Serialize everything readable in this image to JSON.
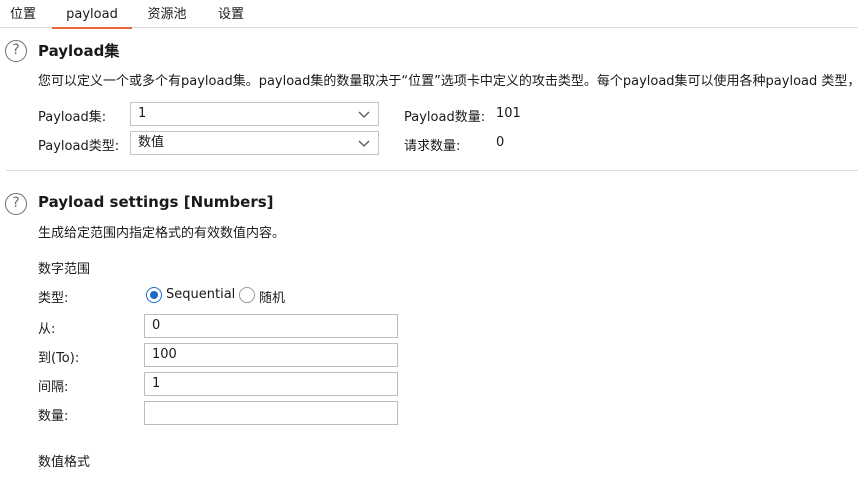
{
  "tabs": [
    {
      "label": "位置"
    },
    {
      "label": "payload"
    },
    {
      "label": "资源池"
    },
    {
      "label": "设置"
    }
  ],
  "payload_sets": {
    "help_glyph": "?",
    "title": "Payload集",
    "description": "您可以定义一个或多个有payload集。payload集的数量取决于“位置”选项卡中定义的攻击类型。每个payload集可以使用各种payload 类型，并且",
    "set_label": "Payload集:",
    "set_value": "1",
    "type_label": "Payload类型:",
    "type_value": "数值",
    "count_label": "Payload数量:",
    "count_value": "101",
    "request_label": "请求数量:",
    "request_value": "0"
  },
  "payload_settings": {
    "help_glyph": "?",
    "title": "Payload settings [Numbers]",
    "description": "生成给定范围内指定格式的有效数值内容。",
    "range_heading": "数字范围",
    "type_label": "类型:",
    "sequential_label": "Sequential",
    "random_label": "随机",
    "selected": "Sequential",
    "from_label": "从:",
    "from_value": "0",
    "to_label": "到(To):",
    "to_value": "100",
    "step_label": "间隔:",
    "step_value": "1",
    "count_label": "数量:",
    "count_value": "",
    "format_heading": "数值格式"
  },
  "colors": {
    "accent_tab": "#e8653a",
    "radio": "#1a6cc8"
  }
}
